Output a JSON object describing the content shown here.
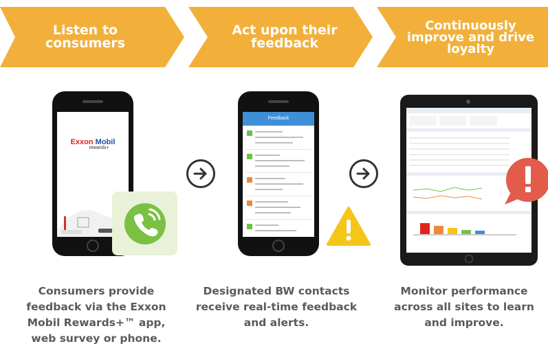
{
  "steps": [
    {
      "title": "Listen to consumers",
      "caption": "Consumers provide feedback via the Exxon Mobil Rewards+™ app, web survey or phone."
    },
    {
      "title": "Act upon their feedback",
      "caption": "Designated BW contacts receive real-time feedback and alerts."
    },
    {
      "title": "Continuously improve and drive loyalty",
      "caption": "Monitor performance across all sites to learn and improve."
    }
  ],
  "phone1": {
    "brand_exxon": "Exxon",
    "brand_mobil": "Mobil",
    "brand_rewards": "rewards+"
  },
  "phone2": {
    "header": "Feedback"
  },
  "colors": {
    "chevron": "#f2b03a",
    "caption_text": "#5a5a5a",
    "exxon_red": "#e2231a",
    "mobil_blue": "#1b4ea3",
    "call_green": "#7ac143",
    "warning_yellow": "#f5c518",
    "alert_red": "#e25b4b",
    "feed_header_blue": "#3f8fd8"
  },
  "icons": [
    "arrow-right-circle-icon",
    "phone-call-icon",
    "warning-icon",
    "alert-bubble-icon"
  ]
}
